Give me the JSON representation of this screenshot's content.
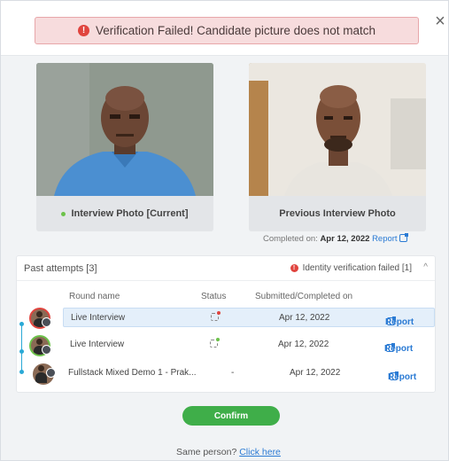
{
  "alert": {
    "message": "Verification Failed! Candidate picture does not match",
    "icon": "alert-circle-icon",
    "color": "#e0443e"
  },
  "close_symbol": "×",
  "photos": {
    "current_caption": "Interview Photo [Current]",
    "previous_caption": "Previous Interview Photo",
    "completed_label": "Completed on:",
    "completed_date": "Apr 12, 2022",
    "report_label": "Report"
  },
  "attempts": {
    "title": "Past attempts [3]",
    "identity_status": "Identity verification failed [1]",
    "caret": "^",
    "columns": {
      "round": "Round name",
      "status": "Status",
      "submitted": "Submitted/Completed on"
    },
    "rows": [
      {
        "round": "Live Interview",
        "status": "",
        "date": "Apr 12, 2022",
        "report": "Report",
        "status_color": "#e0443e"
      },
      {
        "round": "Live Interview",
        "status": "",
        "date": "Apr 12, 2022",
        "report": "Report",
        "status_color": "#6cc24a"
      },
      {
        "round": "Fullstack Mixed Demo 1 - Prak...",
        "status": "-",
        "date": "Apr 12, 2022",
        "report": "Report",
        "status_color": ""
      }
    ]
  },
  "confirm_label": "Confirm",
  "same_person": {
    "text": "Same person?",
    "link": "Click here"
  }
}
